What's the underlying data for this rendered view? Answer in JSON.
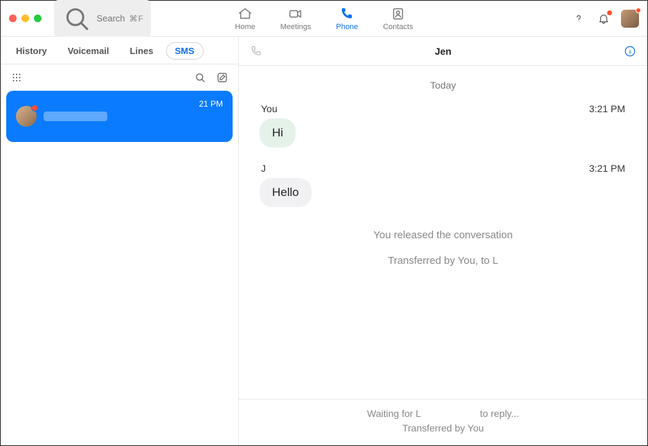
{
  "header": {
    "search_placeholder": "Search",
    "search_shortcut": "⌘F",
    "nav": {
      "home": "Home",
      "meetings": "Meetings",
      "phone": "Phone",
      "contacts": "Contacts"
    }
  },
  "left": {
    "tabs": {
      "history": "History",
      "voicemail": "Voicemail",
      "lines": "Lines",
      "sms": "SMS"
    },
    "threads": [
      {
        "time": "21 PM"
      }
    ]
  },
  "chat": {
    "title": "Jen",
    "date_divider": "Today",
    "messages": [
      {
        "who": "You",
        "time": "3:21 PM",
        "text": "Hi",
        "dir": "out"
      },
      {
        "who": "J",
        "time": "3:21 PM",
        "text": "Hello",
        "dir": "in"
      }
    ],
    "system": {
      "released": "You released the conversation",
      "transfer": "Transferred by You, to L"
    },
    "footer": {
      "waiting": "Waiting for L                      to reply...",
      "transfer_by": "Transferred by You"
    }
  }
}
